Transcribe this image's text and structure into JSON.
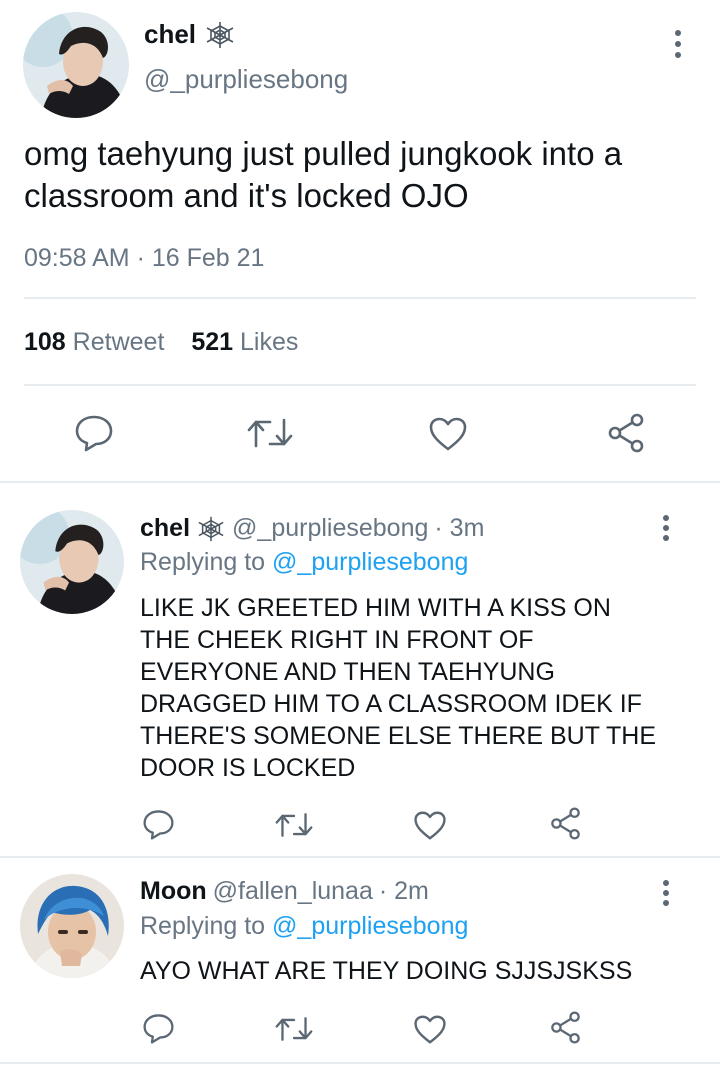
{
  "main_tweet": {
    "display_name": "chel",
    "name_badge_icon": "spider-web-icon",
    "handle": "@_purpliesebong",
    "text_line1": "omg taehyung just pulled jungkook into a",
    "text_line2": "classroom and it's locked OJO",
    "time": "09:58 AM",
    "separator": "·",
    "date": "16 Feb 21",
    "retweet_count": "108",
    "retweet_label": "Retweet",
    "likes_count": "521",
    "likes_label": "Likes"
  },
  "replies": [
    {
      "display_name": "chel",
      "name_badge_icon": "spider-web-icon",
      "handle": "@_purpliesebong",
      "meta": "· 3m",
      "replying_prefix": "Replying to",
      "replying_handle": "@_purpliesebong",
      "lines": [
        "LIKE JK GREETED HIM WITH A KISS ON",
        "THE CHEEK RIGHT IN FRONT OF",
        "EVERYONE AND THEN TAEHYUNG",
        "DRAGGED HIM TO A CLASSROOM IDEK IF",
        "THERE'S SOMEONE ELSE THERE BUT THE",
        "DOOR IS LOCKED"
      ]
    },
    {
      "display_name": "Moon",
      "handle": "@fallen_lunaa",
      "meta": "· 2m",
      "replying_prefix": "Replying to",
      "replying_handle": "@_purpliesebong",
      "lines": [
        "AYO WHAT ARE THEY DOING SJJSJSKSS"
      ]
    }
  ],
  "colors": {
    "text": "#0f1419",
    "muted": "#687684",
    "link": "#1da1f2",
    "divider": "#e6ecf0"
  },
  "icons": [
    "more-vertical-icon",
    "reply-icon",
    "retweet-icon",
    "like-icon",
    "share-icon",
    "spider-web-icon"
  ]
}
